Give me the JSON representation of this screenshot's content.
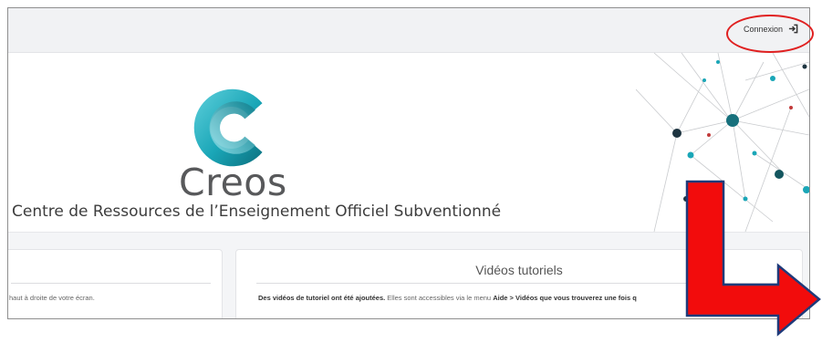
{
  "header": {
    "login_label": "Connexion",
    "login_icon": "sign-in-icon"
  },
  "hero": {
    "brand_name": "Creos",
    "tagline": "Centre de Ressources de l’Enseignement Officiel Subventionné"
  },
  "cards": {
    "left": {
      "text": "haut à droite de votre écran."
    },
    "right": {
      "title": "Vidéos tutoriels",
      "text_bold": "Des vidéos de tutoriel ont été ajoutées.",
      "text_normal": " Elles sont accessibles via le menu ",
      "text_bold2": "Aide > Vidéos que vous trouverez une fois q"
    }
  },
  "colors": {
    "annotation": "#e02020",
    "logo_teal": "#1aa6b7",
    "arrow_fill": "#f20c0c",
    "arrow_outline": "#1f3a7a"
  }
}
